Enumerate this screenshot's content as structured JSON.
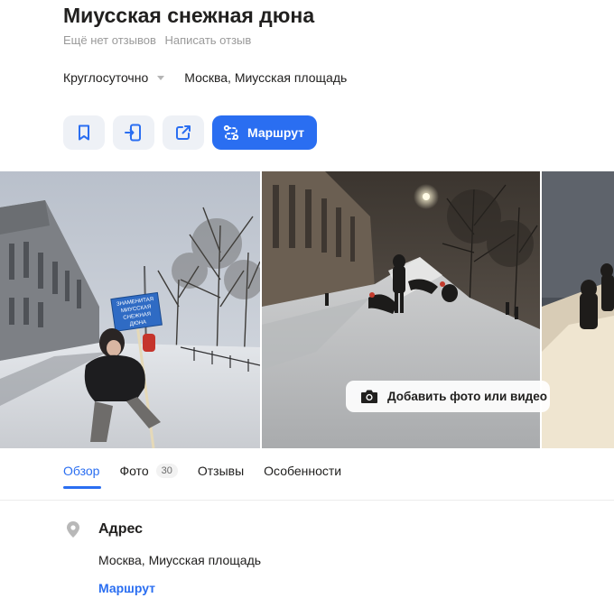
{
  "place": {
    "title": "Миусская снежная дюна",
    "no_reviews": "Ещё нет отзывов",
    "write_review": "Написать отзыв",
    "hours": "Круглосуточно",
    "address_short": "Москва, Миусская площадь"
  },
  "actions": {
    "bookmark_icon": "bookmark-icon",
    "send_to_phone_icon": "phone-send-icon",
    "share_icon": "share-icon",
    "route_label": "Маршрут"
  },
  "gallery": {
    "add_media_label": "Добавить фото или видео",
    "sign_lines": [
      "ЗНАМЕНИТАЯ",
      "МИУССКАЯ",
      "СНЕЖНАЯ",
      "ДЮНА"
    ]
  },
  "tabs": {
    "overview": "Обзор",
    "photos": "Фото",
    "photos_count": "30",
    "reviews": "Отзывы",
    "features": "Особенности"
  },
  "address_section": {
    "title": "Адрес",
    "value": "Москва, Миусская площадь",
    "route_link": "Маршрут"
  },
  "colors": {
    "accent": "#2a6ef1",
    "icon_button_bg": "#eef1f6"
  }
}
